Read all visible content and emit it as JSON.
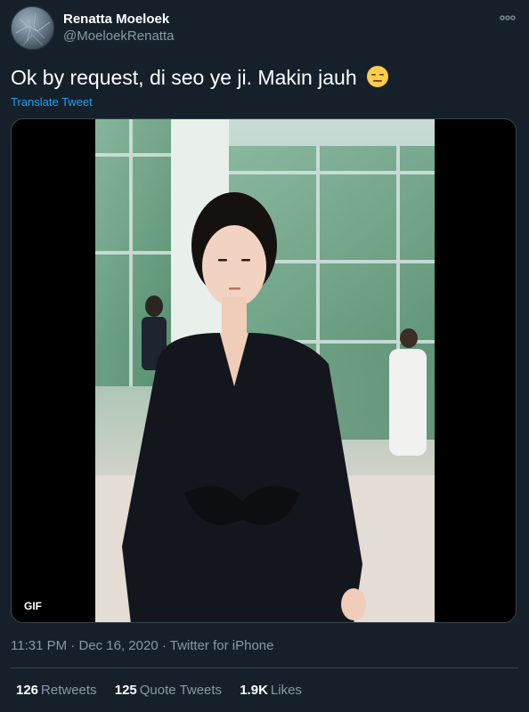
{
  "author": {
    "display_name": "Renatta Moeloek",
    "handle": "@MoeloekRenatta"
  },
  "tweet": {
    "text": "Ok by request, di seo ye ji. Makin jauh",
    "emoji": "expressionless-face",
    "translate_label": "Translate Tweet"
  },
  "media": {
    "badge": "GIF"
  },
  "meta": {
    "time": "11:31 PM",
    "separator1": "·",
    "date": "Dec 16, 2020",
    "separator2": "·",
    "source": "Twitter for iPhone"
  },
  "stats": {
    "retweets_count": "126",
    "retweets_label": "Retweets",
    "quotes_count": "125",
    "quotes_label": "Quote Tweets",
    "likes_count": "1.9K",
    "likes_label": "Likes"
  },
  "colors": {
    "background": "#15202b",
    "secondary_text": "#8899a6",
    "link": "#1da1f2",
    "divider": "#38444d"
  }
}
